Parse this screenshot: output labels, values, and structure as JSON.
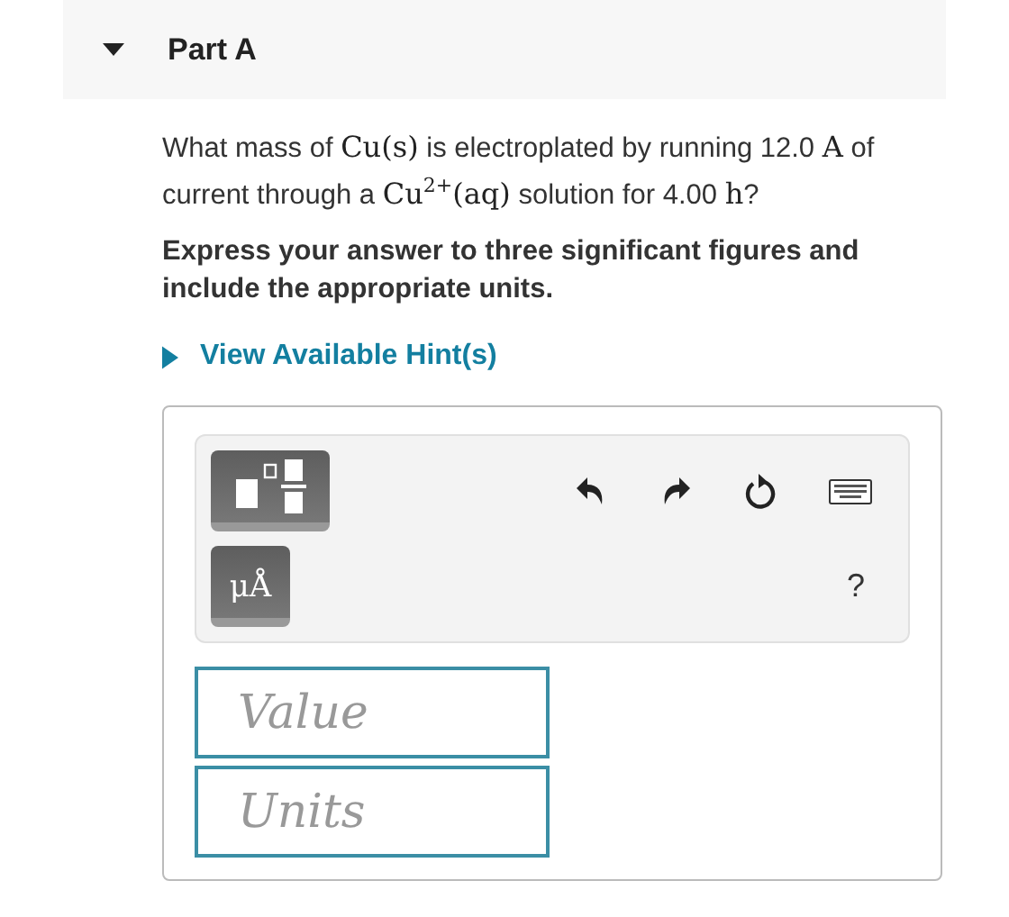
{
  "part": {
    "title": "Part A",
    "expanded": true
  },
  "question": [
    {
      "kind": "text",
      "text": "What mass of "
    },
    {
      "kind": "math",
      "text": "Cu(s)"
    },
    {
      "kind": "text",
      "text": " is electroplated by running 12.0 "
    },
    {
      "kind": "math",
      "text": "A"
    },
    {
      "kind": "text",
      "text": " of current through a "
    },
    {
      "kind": "math",
      "text": "Cu$^{2+}$(aq)"
    },
    {
      "kind": "text",
      "text": " solution for 4.00 "
    },
    {
      "kind": "math",
      "text": "h"
    },
    {
      "kind": "text",
      "text": "?"
    }
  ],
  "instruction": "Express your answer to three significant figures and include the appropriate units.",
  "hint": {
    "label": "View Available Hint(s)",
    "expanded": false
  },
  "units_button": "μÅ",
  "help": "?",
  "fields": [
    {
      "placeholder": "Value"
    },
    {
      "placeholder": "Units"
    }
  ]
}
